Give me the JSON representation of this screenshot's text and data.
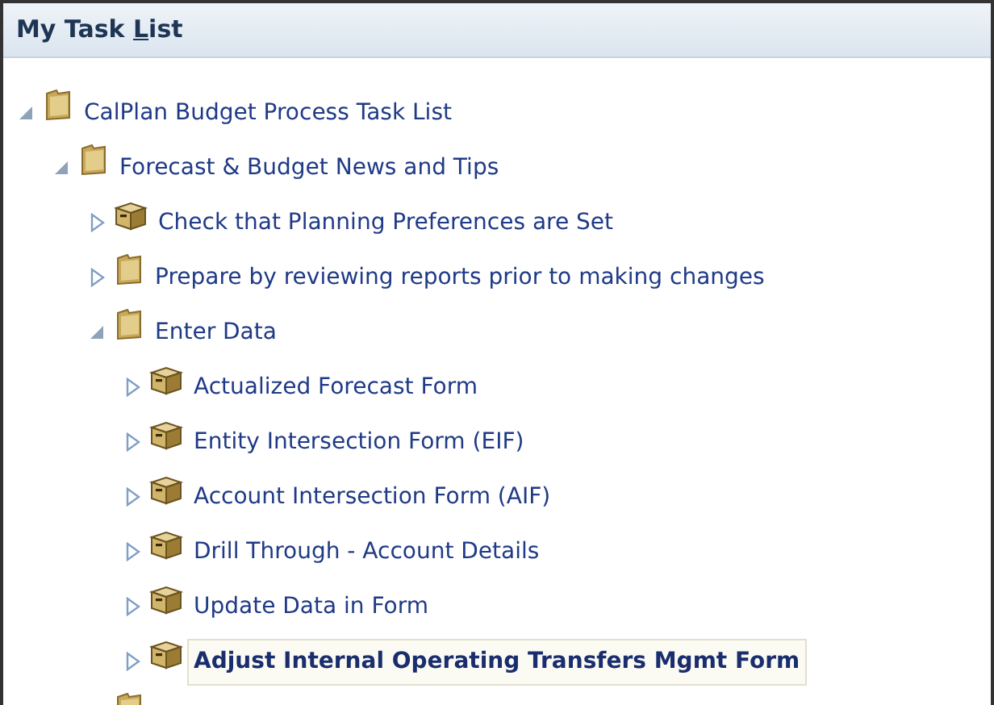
{
  "panel": {
    "title": {
      "before": "My Task ",
      "accesskey": "L",
      "after": "ist"
    }
  },
  "tree": [
    {
      "kind": "folder",
      "label": "CalPlan Budget Process Task List",
      "expanded": true,
      "selected": false,
      "children": [
        {
          "kind": "folder",
          "label": "Forecast & Budget News and Tips",
          "expanded": true,
          "selected": false,
          "children": [
            {
              "kind": "task",
              "label": "Check that Planning Preferences are Set",
              "expanded": false,
              "selected": false
            },
            {
              "kind": "folder",
              "label": "Prepare by reviewing reports prior to making changes",
              "expanded": false,
              "selected": false
            },
            {
              "kind": "folder",
              "label": "Enter Data",
              "expanded": true,
              "selected": false,
              "children": [
                {
                  "kind": "task",
                  "label": "Actualized Forecast Form",
                  "expanded": false,
                  "selected": false
                },
                {
                  "kind": "task",
                  "label": "Entity Intersection Form (EIF)",
                  "expanded": false,
                  "selected": false
                },
                {
                  "kind": "task",
                  "label": "Account Intersection Form (AIF)",
                  "expanded": false,
                  "selected": false
                },
                {
                  "kind": "task",
                  "label": "Drill Through - Account Details",
                  "expanded": false,
                  "selected": false
                },
                {
                  "kind": "task",
                  "label": "Update Data in Form",
                  "expanded": false,
                  "selected": false
                },
                {
                  "kind": "task",
                  "label": "Adjust Internal Operating Transfers Mgmt Form",
                  "expanded": false,
                  "selected": true
                }
              ]
            },
            {
              "kind": "folder"
            }
          ]
        }
      ]
    }
  ]
}
